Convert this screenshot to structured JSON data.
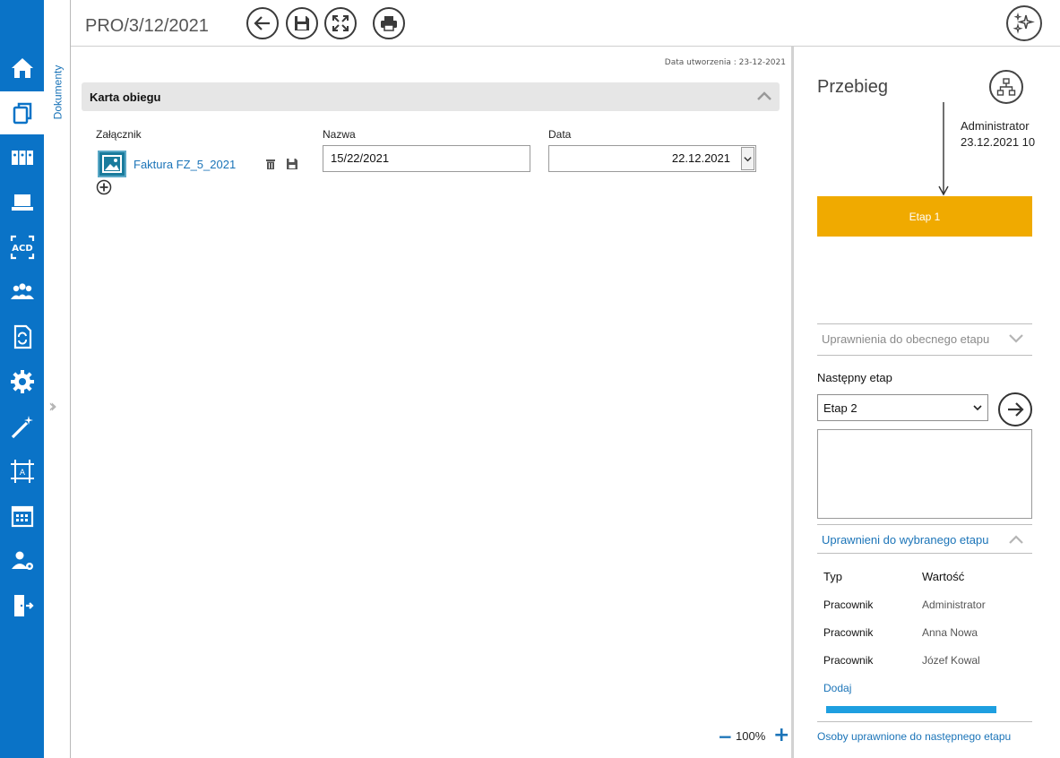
{
  "header": {
    "title": "PRO/3/12/2021",
    "buttons": [
      "back",
      "save",
      "fullscreen",
      "print",
      "magic"
    ]
  },
  "nav": {
    "items": [
      "home",
      "documents",
      "archive",
      "computer",
      "ocr",
      "contractors",
      "workflow",
      "settings",
      "wizard",
      "template",
      "calendar",
      "users",
      "logout"
    ],
    "active": "documents"
  },
  "sidebar": {
    "documents_label": "Dokumenty"
  },
  "main": {
    "created_label": "Data utworzenia : 23-12-2021",
    "card_title": "Karta obiegu",
    "fields": {
      "attachment_label": "Załącznik",
      "attachment_name": "Faktura FZ_5_2021",
      "name_label": "Nazwa",
      "name_value": "15/22/2021",
      "date_label": "Data",
      "date_value": "22.12.2021"
    },
    "zoom": {
      "level": "100%",
      "minus": "−",
      "plus": "+"
    }
  },
  "flow": {
    "title": "Przebieg",
    "user": "Administrator",
    "date": "23.12.2021 10",
    "current_stage": "Etap 1",
    "stage_color": "#f0aa00",
    "perm_current_label": "Uprawnienia do obecnego etapu",
    "next_stage_label": "Następny etap",
    "next_stage_value": "Etap 2",
    "perm_selected_label": "Uprawnieni do wybranego etapu",
    "table": {
      "headers": [
        "Typ",
        "Wartość"
      ],
      "rows": [
        {
          "type": "Pracownik",
          "value": "Administrator"
        },
        {
          "type": "Pracownik",
          "value": "Anna Nowa"
        },
        {
          "type": "Pracownik",
          "value": "Józef Kowal"
        }
      ]
    },
    "add_label": "Dodaj",
    "progress": 1.0,
    "next_people_label": "Osoby uprawnione do następnego etapu"
  },
  "colors": {
    "nav": "#0a73c7",
    "accent": "#1b74b8",
    "stage": "#f0aa00",
    "progress": "#1e9fe0"
  }
}
